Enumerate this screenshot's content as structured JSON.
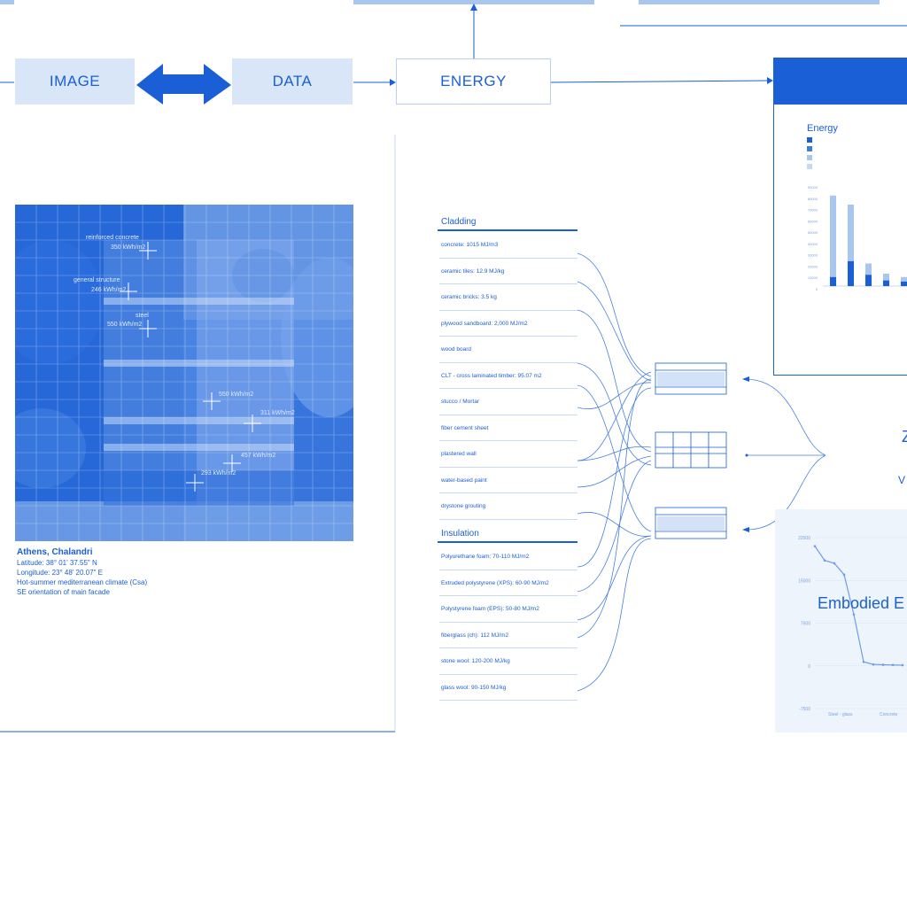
{
  "flow": {
    "image_label": "IMAGE",
    "data_label": "DATA",
    "energy_label": "ENERGY"
  },
  "legend": {
    "title": "Energy",
    "items": [
      "",
      "",
      "",
      ""
    ],
    "colors": [
      "#1a5fd6",
      "#3e7de0",
      "#a9c6ef",
      "#c6d8f4"
    ]
  },
  "photo": {
    "labels": [
      "reinforced concrete",
      "350 kWh/m2",
      "general structure",
      "246 kWh/m2",
      "steel",
      "550 kWh/m2",
      "550 kWh/m2",
      "311 kWh/m2",
      "457 kWh/m2",
      "293 kWh/m2"
    ]
  },
  "location": {
    "title": "Athens, Chalandri",
    "latitude": "Latitude: 38° 01' 37.55\" N",
    "longitude": "Longitude: 23° 48' 20.07\" E",
    "climate": "Hot-summer mediterranean climate (Csa)",
    "facade": "SE orientation of main facade"
  },
  "cladding": {
    "title": "Cladding",
    "items": [
      "concrete: 1015 MJ/m3",
      "ceramic tiles: 12.9 MJ/kg",
      "ceramic bricks: 3.5 kg",
      "plywood sandboard: 2,000 MJ/m2",
      "wood board",
      "CLT - cross laminated timber: 95.07 m2",
      "stucco / Mortar",
      "fiber cement sheet",
      "plastered wall",
      "water-based paint",
      "drystone grouting"
    ]
  },
  "insulation": {
    "title": "Insulation",
    "items": [
      "Polyurethane foam: 70-110 MJ/m2",
      "Extruded polystyrene (XPS): 60-90 MJ/m2",
      "Polystyrene foam (EPS): 50-80 MJ/m2",
      "fiberglass (ch): 112 MJ/m2",
      "stone wool: 120-200 MJ/kg",
      "glass wool: 90-150 MJ/kg"
    ]
  },
  "right": {
    "zee": "Z",
    "vee": "V",
    "embodied": "Embodied E"
  },
  "chart_data": [
    {
      "type": "bar",
      "title": "Energy",
      "categories": [
        "",
        "",
        "",
        "",
        ""
      ],
      "ylabel": "",
      "series": [
        {
          "values": [
            8000,
            22000,
            10000,
            5000,
            4000
          ]
        },
        {
          "values": [
            72000,
            50000,
            10000,
            6000,
            4000
          ]
        }
      ],
      "yticks": [
        "90000",
        "80000",
        "70000",
        "60000",
        "50000",
        "40000",
        "30000",
        "20000",
        "10000",
        "0"
      ]
    },
    {
      "type": "line",
      "title": "Embodied E",
      "yticks": [
        "22500",
        "15000",
        "7500",
        "0",
        "-7500"
      ],
      "categories": [
        "Steel - glass",
        "Concrete"
      ],
      "values": [
        21000,
        18500,
        18000,
        16000,
        9000,
        700,
        250,
        200,
        150,
        120
      ]
    }
  ]
}
